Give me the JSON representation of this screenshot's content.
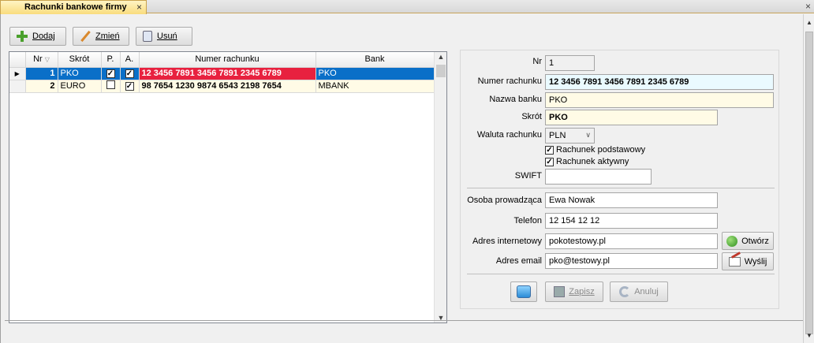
{
  "tab": {
    "title": "Rachunki bankowe firmy",
    "close": "×"
  },
  "window_close": "×",
  "toolbar": {
    "add": "Dodaj",
    "edit": "Zmień",
    "delete": "Usuń"
  },
  "grid": {
    "columns": [
      "Nr",
      "Skrót",
      "P.",
      "A.",
      "Numer rachunku",
      "Bank"
    ],
    "rows": [
      {
        "nr": "1",
        "skrot": "PKO",
        "p": true,
        "a": true,
        "numer": "12 3456 7891 3456 7891 2345 6789",
        "bank": "PKO",
        "selected": true
      },
      {
        "nr": "2",
        "skrot": "EURO",
        "p": false,
        "a": true,
        "numer": "98 7654 1230 9874 6543 2198 7654",
        "bank": "MBANK",
        "selected": false
      }
    ]
  },
  "form": {
    "nr_label": "Nr",
    "nr_value": "1",
    "numer_label": "Numer rachunku",
    "numer_value": "12 3456 7891 3456 7891 2345 6789",
    "bank_label": "Nazwa banku",
    "bank_value": "PKO",
    "skrot_label": "Skrót",
    "skrot_value": "PKO",
    "waluta_label": "Waluta rachunku",
    "waluta_value": "PLN",
    "podst_label": "Rachunek podstawowy",
    "podst_checked": true,
    "aktyw_label": "Rachunek aktywny",
    "aktyw_checked": true,
    "swift_label": "SWIFT",
    "swift_value": "",
    "osoba_label": "Osoba prowadząca",
    "osoba_value": "Ewa Nowak",
    "telefon_label": "Telefon",
    "telefon_value": "12 154 12 12",
    "www_label": "Adres internetowy",
    "www_value": "pokotestowy.pl",
    "open_label": "Otwórz",
    "email_label": "Adres email",
    "email_value": "pko@testowy.pl",
    "send_label": "Wyślij",
    "save_label": "Zapisz",
    "cancel_label": "Anuluj"
  },
  "colors": {
    "selection": "#0a6fc8",
    "highlight": "#e8213f",
    "tab": "#f9dc7d"
  }
}
